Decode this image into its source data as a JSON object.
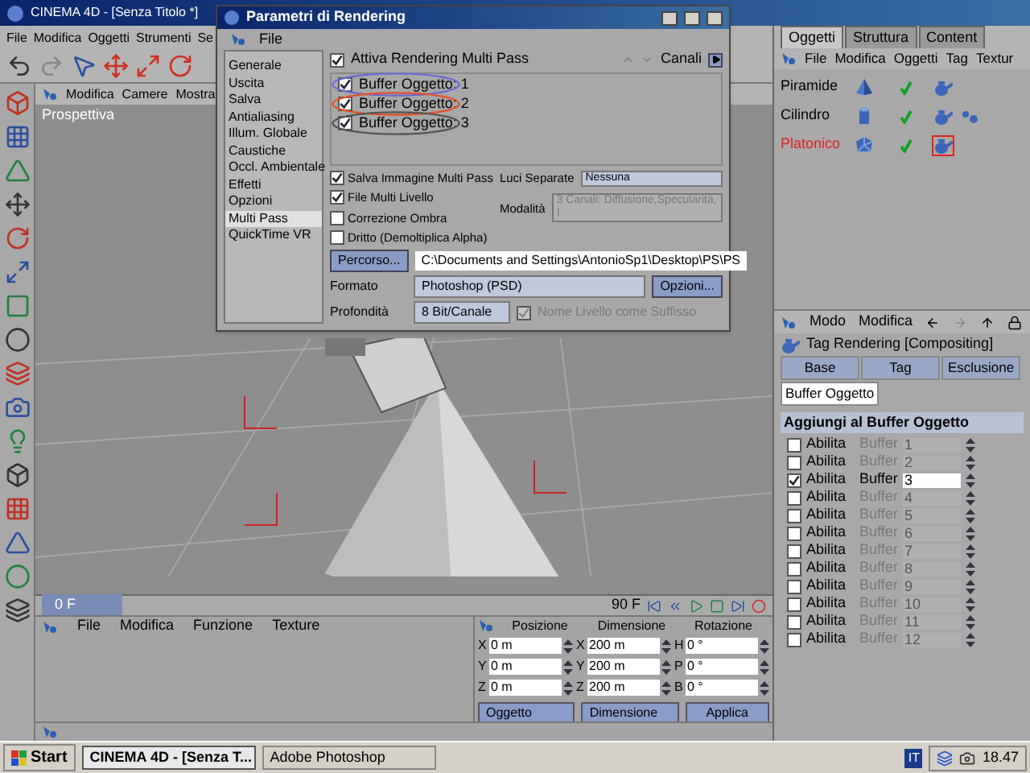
{
  "app": {
    "title": "CINEMA 4D - [Senza Titolo *]",
    "menu": [
      "File",
      "Modifica",
      "Oggetti",
      "Strumenti",
      "Se"
    ]
  },
  "viewport": {
    "menu": [
      "Modifica",
      "Camere",
      "Mostra"
    ],
    "label": "Prospettiva"
  },
  "dialog": {
    "title": "Parametri di Rendering",
    "menu": [
      "File"
    ],
    "nav": [
      {
        "label": "Generale",
        "selected": false
      },
      {
        "label": "Uscita",
        "selected": false
      },
      {
        "label": "Salva",
        "selected": false
      },
      {
        "label": "Antialiasing",
        "selected": false
      },
      {
        "label": "Illum. Globale",
        "selected": false
      },
      {
        "label": "Caustiche",
        "selected": false
      },
      {
        "label": "Occl. Ambientale",
        "selected": false
      },
      {
        "label": "Effetti",
        "selected": false
      },
      {
        "label": "Opzioni",
        "selected": false
      },
      {
        "label": "Multi Pass",
        "selected": true
      },
      {
        "label": "QuickTime VR",
        "selected": false
      }
    ],
    "enable": {
      "label": "Attiva Rendering Multi Pass",
      "checked": true
    },
    "channels_label": "Canali",
    "passes": [
      {
        "label": "Buffer Oggetto: 1",
        "checked": true,
        "color": "#6b6bd6"
      },
      {
        "label": "Buffer Oggetto: 2",
        "checked": true,
        "color": "#e8502a"
      },
      {
        "label": "Buffer Oggetto: 3",
        "checked": true,
        "color": "#555555"
      }
    ],
    "options": [
      {
        "label": "Salva Immagine Multi Pass",
        "checked": true
      },
      {
        "label": "File Multi Livello",
        "checked": true
      },
      {
        "label": "Correzione Ombra",
        "checked": false
      },
      {
        "label": "Dritto (Demoltiplica Alpha)",
        "checked": false
      }
    ],
    "lights": {
      "label": "Luci Separate",
      "value": "Nessuna",
      "disabled": false
    },
    "mode": {
      "label": "Modalità",
      "value": "3 Canali: Diffusione,Specularità,I",
      "disabled": true
    },
    "path_button": "Percorso...",
    "path": "C:\\Documents and Settings\\AntonioSp1\\Desktop\\PS\\PS",
    "format": {
      "label": "Formato",
      "value": "Photoshop (PSD)",
      "button": "Opzioni..."
    },
    "depth": {
      "label": "Profondità",
      "value": "8 Bit/Canale"
    },
    "suffix": {
      "label": "Nome Livello come Suffisso",
      "checked": true,
      "disabled": true
    }
  },
  "objects_panel": {
    "tabs": [
      {
        "label": "Oggetti",
        "selected": true
      },
      {
        "label": "Struttura",
        "selected": false
      },
      {
        "label": "Content",
        "selected": false
      }
    ],
    "menu": [
      "File",
      "Modifica",
      "Oggetti",
      "Tag",
      "Textur"
    ],
    "objects": [
      {
        "name": "Piramide",
        "kind": "pyramid",
        "selected": false,
        "extra_tag": false,
        "tag_selected": false
      },
      {
        "name": "Cilindro",
        "kind": "cylinder",
        "selected": false,
        "extra_tag": true,
        "tag_selected": false
      },
      {
        "name": "Platonico",
        "kind": "platonic",
        "selected": true,
        "extra_tag": false,
        "tag_selected": true
      }
    ]
  },
  "attributes": {
    "menu": [
      "Modo",
      "Modifica"
    ],
    "title": "Tag Rendering [Compositing]",
    "tabs": [
      {
        "label": "Base",
        "selected": false
      },
      {
        "label": "Tag",
        "selected": false
      },
      {
        "label": "Esclusione",
        "selected": false
      },
      {
        "label": "Buffer Oggetto",
        "selected": true
      }
    ],
    "section": "Aggiungi al Buffer Oggetto",
    "buffers": [
      {
        "enable": "Abilita",
        "label": "Buffer",
        "value": "1",
        "checked": false
      },
      {
        "enable": "Abilita",
        "label": "Buffer",
        "value": "2",
        "checked": false
      },
      {
        "enable": "Abilita",
        "label": "Buffer",
        "value": "3",
        "checked": true
      },
      {
        "enable": "Abilita",
        "label": "Buffer",
        "value": "4",
        "checked": false
      },
      {
        "enable": "Abilita",
        "label": "Buffer",
        "value": "5",
        "checked": false
      },
      {
        "enable": "Abilita",
        "label": "Buffer",
        "value": "6",
        "checked": false
      },
      {
        "enable": "Abilita",
        "label": "Buffer",
        "value": "7",
        "checked": false
      },
      {
        "enable": "Abilita",
        "label": "Buffer",
        "value": "8",
        "checked": false
      },
      {
        "enable": "Abilita",
        "label": "Buffer",
        "value": "9",
        "checked": false
      },
      {
        "enable": "Abilita",
        "label": "Buffer",
        "value": "10",
        "checked": false
      },
      {
        "enable": "Abilita",
        "label": "Buffer",
        "value": "11",
        "checked": false
      },
      {
        "enable": "Abilita",
        "label": "Buffer",
        "value": "12",
        "checked": false
      }
    ]
  },
  "timeline": {
    "start": "0 F",
    "end": "90 F"
  },
  "materials": {
    "menu": [
      "File",
      "Modifica",
      "Funzione",
      "Texture"
    ]
  },
  "coordinates": {
    "headers": [
      "Posizione",
      "Dimensione",
      "Rotazione"
    ],
    "rows": [
      [
        {
          "axis": "X",
          "value": "0 m"
        },
        {
          "axis": "X",
          "value": "200 m"
        },
        {
          "axis": "H",
          "value": "0 °"
        }
      ],
      [
        {
          "axis": "Y",
          "value": "0 m"
        },
        {
          "axis": "Y",
          "value": "200 m"
        },
        {
          "axis": "P",
          "value": "0 °"
        }
      ],
      [
        {
          "axis": "Z",
          "value": "0 m"
        },
        {
          "axis": "Z",
          "value": "200 m"
        },
        {
          "axis": "B",
          "value": "0 °"
        }
      ]
    ],
    "dropdowns": [
      "Oggetto",
      "Dimensione"
    ],
    "apply": "Applica"
  },
  "taskbar": {
    "start": "Start",
    "tasks": [
      {
        "label": "CINEMA 4D - [Senza T...",
        "selected": true
      },
      {
        "label": "Adobe Photoshop",
        "selected": false
      }
    ],
    "lang": "IT",
    "time": "18.47"
  }
}
